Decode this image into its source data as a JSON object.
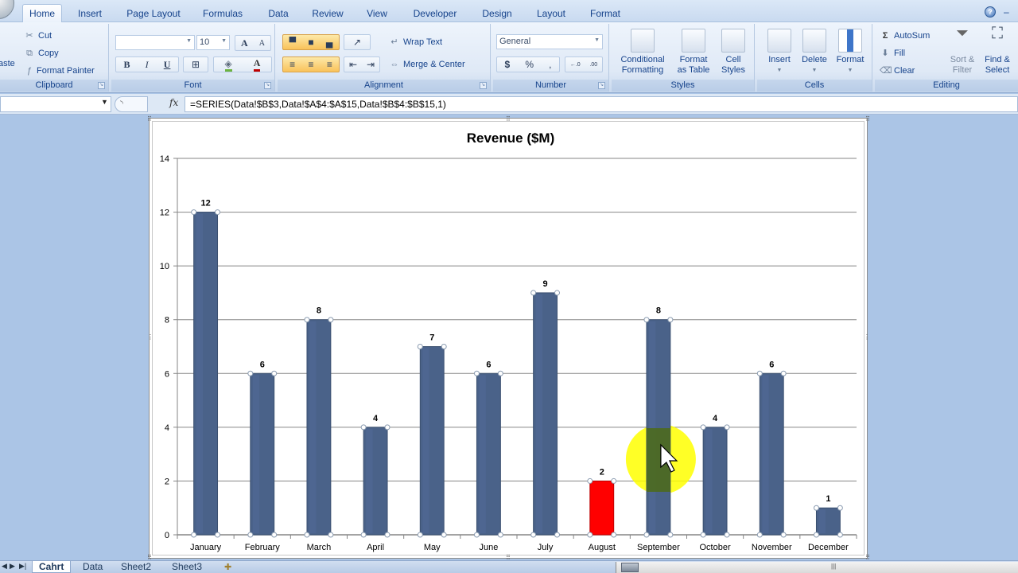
{
  "ribbon": {
    "tabs": [
      "Home",
      "Insert",
      "Page Layout",
      "Formulas",
      "Data",
      "Review",
      "View",
      "Developer",
      "Design",
      "Layout",
      "Format"
    ],
    "active_tab": "Home",
    "clipboard": {
      "paste": "aste",
      "cut": "Cut",
      "copy": "Copy",
      "format_painter": "Format Painter",
      "label": "Clipboard"
    },
    "font": {
      "font_name": "",
      "font_size": "10",
      "bold": "B",
      "italic": "I",
      "underline": "U",
      "grow": "A",
      "shrink": "A",
      "label": "Font"
    },
    "alignment": {
      "wrap_text": "Wrap Text",
      "merge_center": "Merge & Center",
      "label": "Alignment"
    },
    "number": {
      "format": "General",
      "currency": "$",
      "percent": "%",
      "comma": ",",
      "inc_decimal": "+.0 .00",
      "dec_decimal": ".00 +.0",
      "label": "Number"
    },
    "styles": {
      "conditional_1": "Conditional",
      "conditional_2": "Formatting",
      "table_1": "Format",
      "table_2": "as Table",
      "cell_1": "Cell",
      "cell_2": "Styles",
      "label": "Styles"
    },
    "cells": {
      "insert": "Insert",
      "delete": "Delete",
      "format": "Format",
      "label": "Cells"
    },
    "editing": {
      "autosum": "AutoSum",
      "fill": "Fill",
      "clear": "Clear",
      "sort_1": "Sort &",
      "sort_2": "Filter",
      "find_1": "Find &",
      "find_2": "Select",
      "label": "Editing"
    }
  },
  "formula_bar": {
    "name_box": "",
    "fx": "fx",
    "formula": "=SERIES(Data!$B$3,Data!$A$4:$A$15,Data!$B$4:$B$15,1)"
  },
  "sheet_tabs": [
    "Cahrt",
    "Data",
    "Sheet2",
    "Sheet3"
  ],
  "active_sheet": "Cahrt",
  "colors": {
    "bar": "#4a6289",
    "highlight_bar": "#ff0000",
    "cursor_halo": "#ffff00"
  },
  "chart_data": {
    "type": "bar",
    "title": "Revenue ($M)",
    "xlabel": "",
    "ylabel": "",
    "categories": [
      "January",
      "February",
      "March",
      "April",
      "May",
      "June",
      "July",
      "August",
      "September",
      "October",
      "November",
      "December"
    ],
    "values": [
      12,
      6,
      8,
      4,
      7,
      6,
      9,
      2,
      8,
      4,
      6,
      1
    ],
    "data_labels": [
      "12",
      "6",
      "8",
      "4",
      "7",
      "6",
      "9",
      "2",
      "8",
      "4",
      "6",
      "1"
    ],
    "highlighted_category": "August",
    "ylim": [
      0,
      14
    ],
    "yticks": [
      0,
      2,
      4,
      6,
      8,
      10,
      12,
      14
    ],
    "ytick_labels": [
      "0",
      "2",
      "4",
      "6",
      "8",
      "10",
      "12",
      "14"
    ],
    "grid": true,
    "legend": "none"
  }
}
